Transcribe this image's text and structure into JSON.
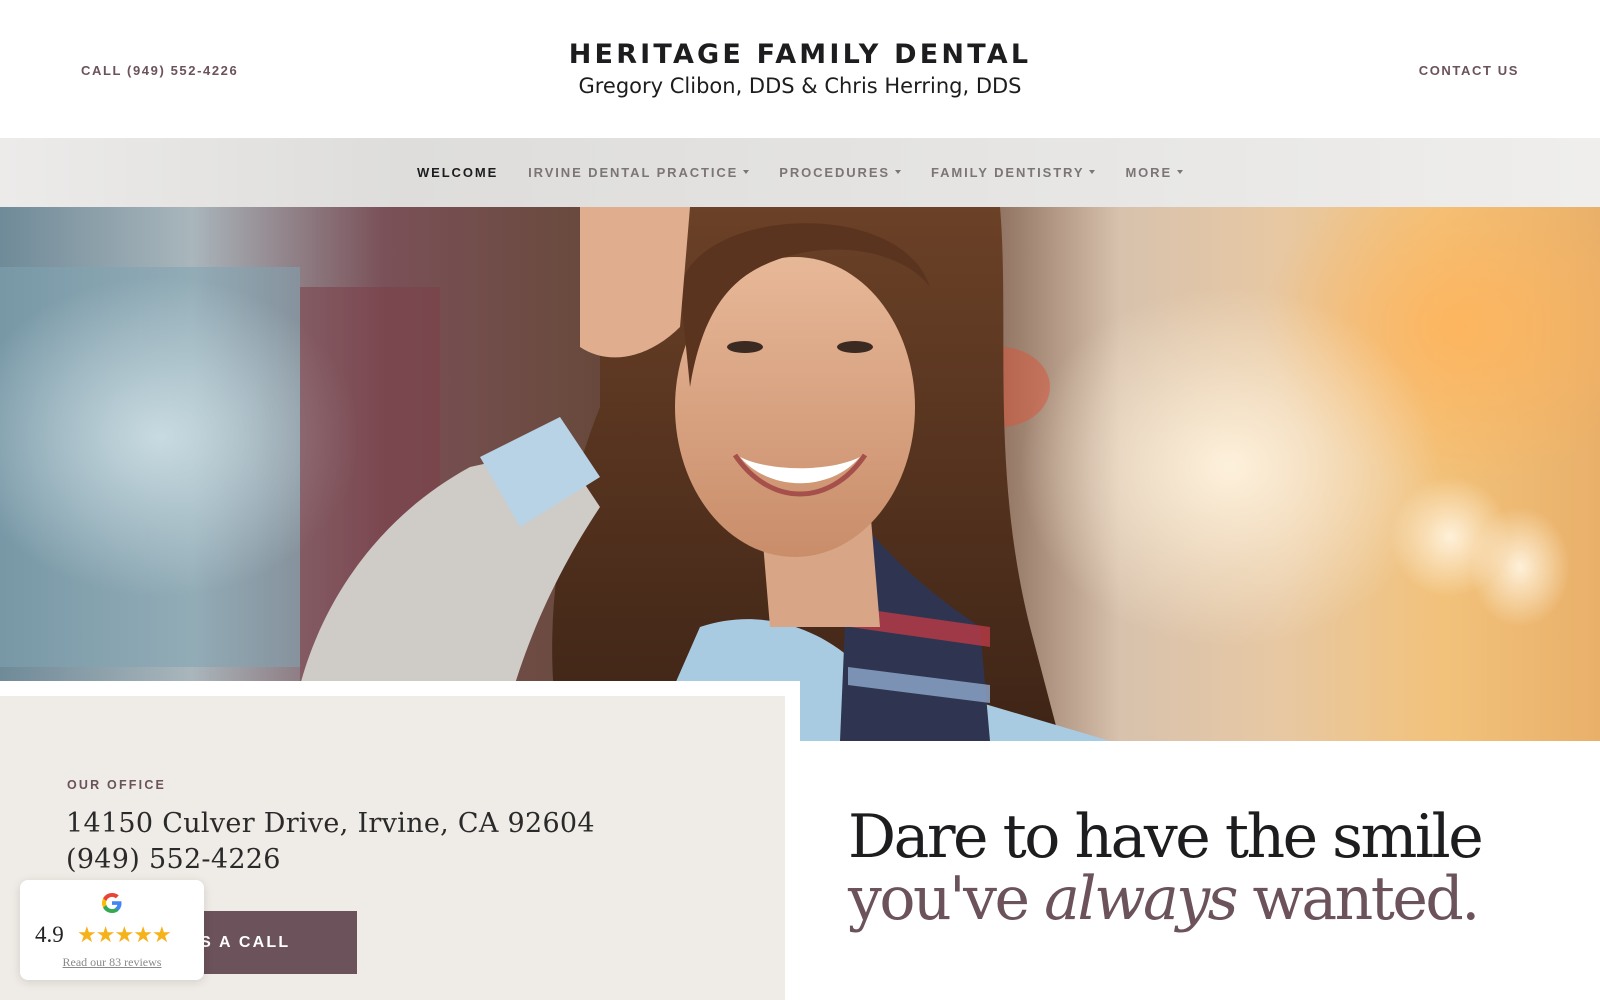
{
  "header": {
    "call_label": "CALL (949) 552-4226",
    "title": "HERITAGE FAMILY DENTAL",
    "subtitle": "Gregory Clibon, DDS & Chris Herring, DDS",
    "contact_label": "CONTACT US"
  },
  "nav": {
    "items": [
      {
        "label": "WELCOME",
        "active": true,
        "dropdown": false
      },
      {
        "label": "IRVINE DENTAL PRACTICE",
        "active": false,
        "dropdown": true
      },
      {
        "label": "PROCEDURES",
        "active": false,
        "dropdown": true
      },
      {
        "label": "FAMILY DENTISTRY",
        "active": false,
        "dropdown": true
      },
      {
        "label": "MORE",
        "active": false,
        "dropdown": true
      }
    ]
  },
  "office": {
    "label": "OUR OFFICE",
    "address": "14150 Culver Drive, Irvine, CA 92604",
    "phone": "(949) 552-4226",
    "button_label": "GIVE US A CALL"
  },
  "tagline": {
    "line1": "Dare to have the smile",
    "line2_before": "you've ",
    "line2_em": "always",
    "line2_after": " wanted."
  },
  "reviews": {
    "icon": "google-icon",
    "rating": "4.9",
    "stars": 5,
    "link_label": "Read our 83 reviews"
  },
  "colors": {
    "accent": "#6b525b",
    "nav_active": "#1d1d1f",
    "nav_inactive": "#7c7577",
    "office_bg": "#efebe6",
    "star": "#f6b21b"
  }
}
